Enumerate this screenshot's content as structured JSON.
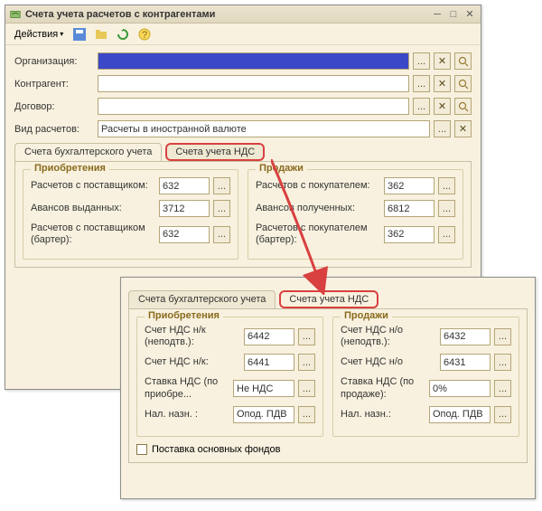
{
  "window": {
    "title": "Счета учета расчетов с контрагентами",
    "actions_label": "Действия"
  },
  "form": {
    "org_label": "Организация:",
    "org_value": "",
    "cont_label": "Контрагент:",
    "cont_value": "",
    "dog_label": "Договор:",
    "dog_value": "",
    "vid_label": "Вид расчетов:",
    "vid_value": "Расчеты в иностранной валюте"
  },
  "tabs1": {
    "buh": "Счета бухгалтерского учета",
    "nds": "Счета учета НДС"
  },
  "panel1": {
    "acq_title": "Приобретения",
    "sale_title": "Продажи",
    "acq": {
      "r1_label": "Расчетов с поставщиком:",
      "r1_value": "632",
      "r2_label": "Авансов выданных:",
      "r2_value": "3712",
      "r3_label": "Расчетов с поставщиком (бартер):",
      "r3_value": "632"
    },
    "sale": {
      "r1_label": "Расчетов с покупателем:",
      "r1_value": "362",
      "r2_label": "Авансов полученных:",
      "r2_value": "6812",
      "r3_label": "Расчетов с покупателем (бартер):",
      "r3_value": "362"
    }
  },
  "tabs2": {
    "buh": "Счета бухгалтерского учета",
    "nds": "Счета учета НДС"
  },
  "panel2": {
    "acq_title": "Приобретения",
    "sale_title": "Продажи",
    "acq": {
      "r1_label": "Счет НДС н/к (неподтв.):",
      "r1_value": "6442",
      "r2_label": "Счет НДС н/к:",
      "r2_value": "6441",
      "r3_label": "Ставка НДС (по приобре...",
      "r3_value": "Не НДС",
      "r4_label": "Нал. назн. :",
      "r4_value": "Опод. ПДВ"
    },
    "sale": {
      "r1_label": "Счет НДС н/о (неподтв.):",
      "r1_value": "6432",
      "r2_label": "Счет НДС н/о",
      "r2_value": "6431",
      "r3_label": "Ставка НДС (по продаже):",
      "r3_value": "0%",
      "r4_label": "Нал. назн.:",
      "r4_value": "Опод. ПДВ"
    },
    "checkbox_label": "Поставка основных фондов"
  },
  "ellipsis": "...",
  "x_btn": "✕"
}
